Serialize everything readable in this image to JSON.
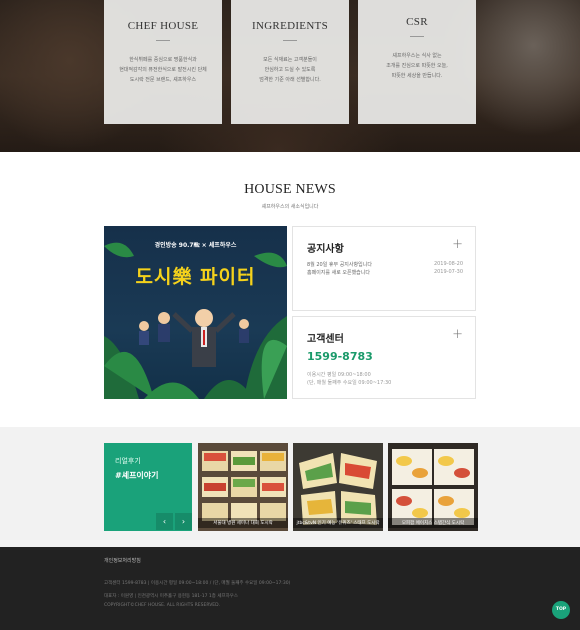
{
  "brand_cards": [
    {
      "title": "CHEF HOUSE",
      "desc": [
        "한식뷔페를 중심으로 명품한식과",
        "현대적감각의 퓨전한식으로 발전시킨 단체",
        "도시락 전문 브랜드, 셰프하우스"
      ]
    },
    {
      "title": "INGREDIENTS",
      "desc": [
        "모든 식재료는 고객분들이",
        "안심하고 드실 수 있도록",
        "엄격한 기준 아래 선별합니다."
      ]
    },
    {
      "title": "CSR",
      "desc": [
        "셰프하우스는 식사 없는",
        "조개를 진심으로 따뜻한 오늘,",
        "따뜻한 세상을 만듭니다."
      ]
    }
  ],
  "news": {
    "heading": "HOUSE NEWS",
    "subheading": "셰프하우스의 새소식입니다",
    "banner": {
      "top_text": "경인방송 90.7㎒ × 셰프하우스",
      "title": "도시樂 파이터"
    },
    "notice": {
      "title": "공지사항",
      "plus": "+",
      "items": [
        {
          "text": "8월 20일 휴무 공지사항입니다",
          "date": "2019-08-20"
        },
        {
          "text": "홈페이지를 새로 오픈했습니다",
          "date": "2019-07-30"
        }
      ]
    },
    "customer": {
      "title": "고객센터",
      "plus": "+",
      "phone": "1599-8783",
      "hours": [
        "이용시간 평일 09:00~18:00",
        "(단, 매월 둘째주 수요일 09:00~17:30"
      ]
    }
  },
  "reviews": {
    "line1": "리얼후기",
    "line2": "#셰프이야기",
    "prev": "‹",
    "next": "›",
    "photos": [
      {
        "caption": "서울대 병원 세미나 대회 도시락"
      },
      {
        "caption": "jtbc&tvN 인기 예능 '유퀴즈' 스태프 도시락"
      },
      {
        "caption": "모피팜 에이치스 스탭간식 도시락"
      }
    ]
  },
  "footer": {
    "link": "개인정보처리방침",
    "lines": [
      "고객센터 1599-8783 | 이용시간 평일 09:00~18:00 / (단, 매월 둘째주 수요일 09:00~17:30)",
      "대표자 : 이원영 | 인천광역시 미추홀구 용현동 181-17 1층 셰프하우스",
      "COPYRIGHT©CHEF HOUSE. ALL RIGHTS RESERVED."
    ]
  },
  "top_button": "TOP",
  "colors": {
    "accent": "#1aa27a",
    "phone": "#1a9a6a",
    "footer_bg": "#222222",
    "banner_title": "#f5d21b"
  }
}
